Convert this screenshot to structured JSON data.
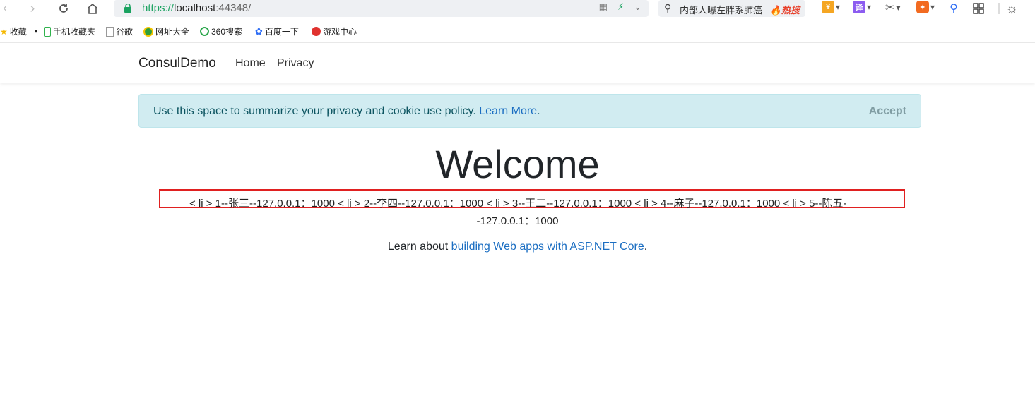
{
  "browser": {
    "url_scheme": "https://",
    "url_host": "localhost",
    "url_port": ":44348/",
    "search_query": "内部人曝左胖系肺癌",
    "search_hot": "热搜",
    "translate_label": "译"
  },
  "bookmarks": [
    {
      "label": "收藏",
      "color": "#f5b800"
    },
    {
      "label": "手机收藏夹",
      "color": "#2fb24c"
    },
    {
      "label": "谷歌",
      "color": "#999999"
    },
    {
      "label": "网址大全",
      "color": "#2e9e3c"
    },
    {
      "label": "360搜索",
      "color": "#2fa84f"
    },
    {
      "label": "百度一下",
      "color": "#2f6ef5"
    },
    {
      "label": "游戏中心",
      "color": "#e0322f"
    }
  ],
  "navbar": {
    "brand": "ConsulDemo",
    "links": [
      "Home",
      "Privacy"
    ]
  },
  "cookie": {
    "message": "Use this space to summarize your privacy and cookie use policy.",
    "link": "Learn More",
    "link_suffix": ".",
    "accept": "Accept"
  },
  "main": {
    "title": "Welcome",
    "list_line1": "< li > 1--张三--127.0.0.1：1000 < li > 2--李四--127.0.0.1：1000 < li > 3--王二--127.0.0.1：1000 < li > 4--麻子--127.0.0.1：1000 < li > 5--陈五-",
    "list_line2": "-127.0.0.1：1000",
    "learn_prefix": "Learn about ",
    "learn_link": "building Web apps with ASP.NET Core",
    "learn_suffix": "."
  }
}
